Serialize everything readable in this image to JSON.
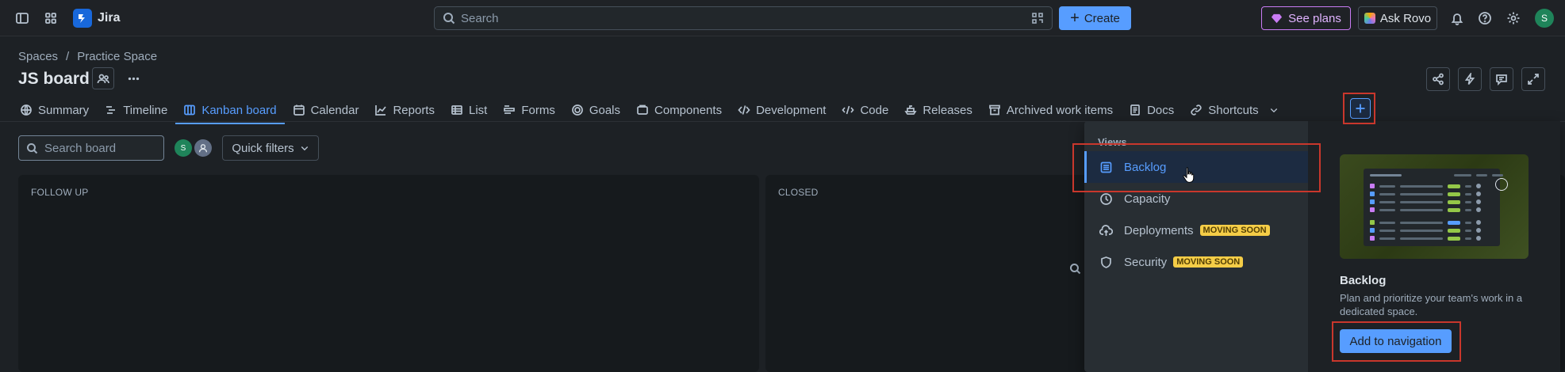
{
  "topbar": {
    "app_name": "Jira",
    "search_placeholder": "Search",
    "create_label": "Create",
    "plans_label": "See plans",
    "rovo_label": "Ask Rovo",
    "avatar_initial": "S"
  },
  "header": {
    "breadcrumb": [
      "Spaces",
      "/",
      "Practice Space"
    ],
    "title": "JS board"
  },
  "tabs": [
    {
      "label": "Summary",
      "icon": "globe-icon"
    },
    {
      "label": "Timeline",
      "icon": "timeline-icon"
    },
    {
      "label": "Kanban board",
      "icon": "board-icon",
      "active": true
    },
    {
      "label": "Calendar",
      "icon": "calendar-icon"
    },
    {
      "label": "Reports",
      "icon": "chart-icon"
    },
    {
      "label": "List",
      "icon": "list-icon"
    },
    {
      "label": "Forms",
      "icon": "forms-icon"
    },
    {
      "label": "Goals",
      "icon": "goal-icon"
    },
    {
      "label": "Components",
      "icon": "component-icon"
    },
    {
      "label": "Development",
      "icon": "development-icon"
    },
    {
      "label": "Code",
      "icon": "code-icon"
    },
    {
      "label": "Releases",
      "icon": "ship-icon"
    },
    {
      "label": "Archived work items",
      "icon": "archive-icon"
    },
    {
      "label": "Docs",
      "icon": "page-icon"
    },
    {
      "label": "Shortcuts",
      "icon": "link-icon"
    }
  ],
  "board": {
    "search_placeholder": "Search board",
    "avatar_initial": "S",
    "quick_filters_label": "Quick filters",
    "columns": [
      "FOLLOW UP",
      "CLOSED"
    ]
  },
  "dropdown": {
    "heading": "Views",
    "items": [
      {
        "label": "Backlog",
        "badge": ""
      },
      {
        "label": "Capacity",
        "badge": ""
      },
      {
        "label": "Deployments",
        "badge": "MOVING SOON"
      },
      {
        "label": "Security",
        "badge": "MOVING SOON"
      }
    ],
    "preview_title": "Backlog",
    "preview_description": "Plan and prioritize your team's work in a dedicated space.",
    "add_button": "Add to navigation"
  },
  "colors": {
    "accent": "#579dff",
    "background": "#1d2125",
    "lozenge": "#f5cd47",
    "annotation": "#c9372c"
  }
}
